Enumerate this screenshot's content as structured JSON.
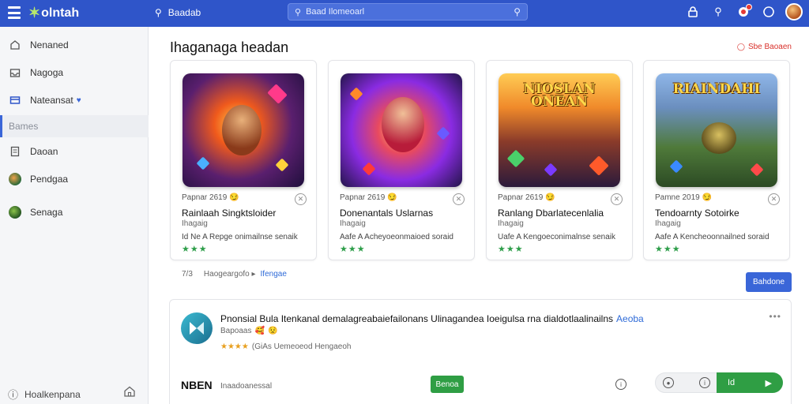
{
  "header": {
    "logo_text": "olntah",
    "search_label": "Baadab",
    "search_placeholder": "Baad Ilomeoarl",
    "icons": [
      "menu-icon",
      "search-icon",
      "lock-icon",
      "search-icon",
      "notification-icon",
      "info-icon",
      "avatar"
    ]
  },
  "sidebar": {
    "items": [
      {
        "label": "Nenaned",
        "icon": "home-outline-icon"
      },
      {
        "label": "Nagoga",
        "icon": "inbox-icon"
      },
      {
        "label": "Nateansat",
        "icon": "card-icon"
      }
    ],
    "section_label": "Bames",
    "items_after": [
      {
        "label": "Daoan",
        "icon": "document-icon"
      },
      {
        "label": "Pendgaa",
        "icon": "game-avatar-icon"
      },
      {
        "label": "Senaga",
        "icon": "planet-icon"
      }
    ],
    "bottom_label": "Hoalkenpana"
  },
  "main": {
    "heading": "Ihaganaga headan",
    "see_more": "Sbe Baoaen",
    "cards": [
      {
        "meta": "Papnar 2619",
        "title": "Rainlaah Singktsloider",
        "sub": "Ihagaig",
        "desc": "Id Ne A Repge onimailnse senaik",
        "art_title": ""
      },
      {
        "meta": "Papnar 2619",
        "title": "Donenantals Uslarnas",
        "sub": "Ihagaig",
        "desc": "Aafe A Acheyoeonmaioed soraid",
        "art_title": ""
      },
      {
        "meta": "Papnar 2619",
        "title": "Ranlang Dbarlatecenlalia",
        "sub": "Ihagaig",
        "desc": "Uafe A Kengoeconimalnse senaik",
        "art_title": "NIOSLAN ONEAN"
      },
      {
        "meta": "Pamne 2019",
        "title": "Tendoarnty Sotoirke",
        "sub": "Ihagaig",
        "desc": "Aafe A Kencheoonnailned soraid",
        "art_title": "RIAINDAHI"
      }
    ],
    "pager_num": "7/3",
    "pager_text": "Haogeargofo ▸",
    "pager_link": "Ifengae",
    "blue_button": "Bahdone",
    "feature": {
      "title": "Pnonsial Bula Itenkanal demalagreabaiefailonans Ulinagandea Ioeigulsa rna dialdotlaalinailns",
      "title_link": "Aeoba",
      "sub": "Bapoaas",
      "rating_stars": "★★★★",
      "rating_text": "(GiAs Uemeoeod Hengaeoh",
      "code": "NBEN",
      "desc": "Inaadoanessal",
      "green_button": "Benoa",
      "action_label": "Id",
      "more": "•••"
    }
  }
}
